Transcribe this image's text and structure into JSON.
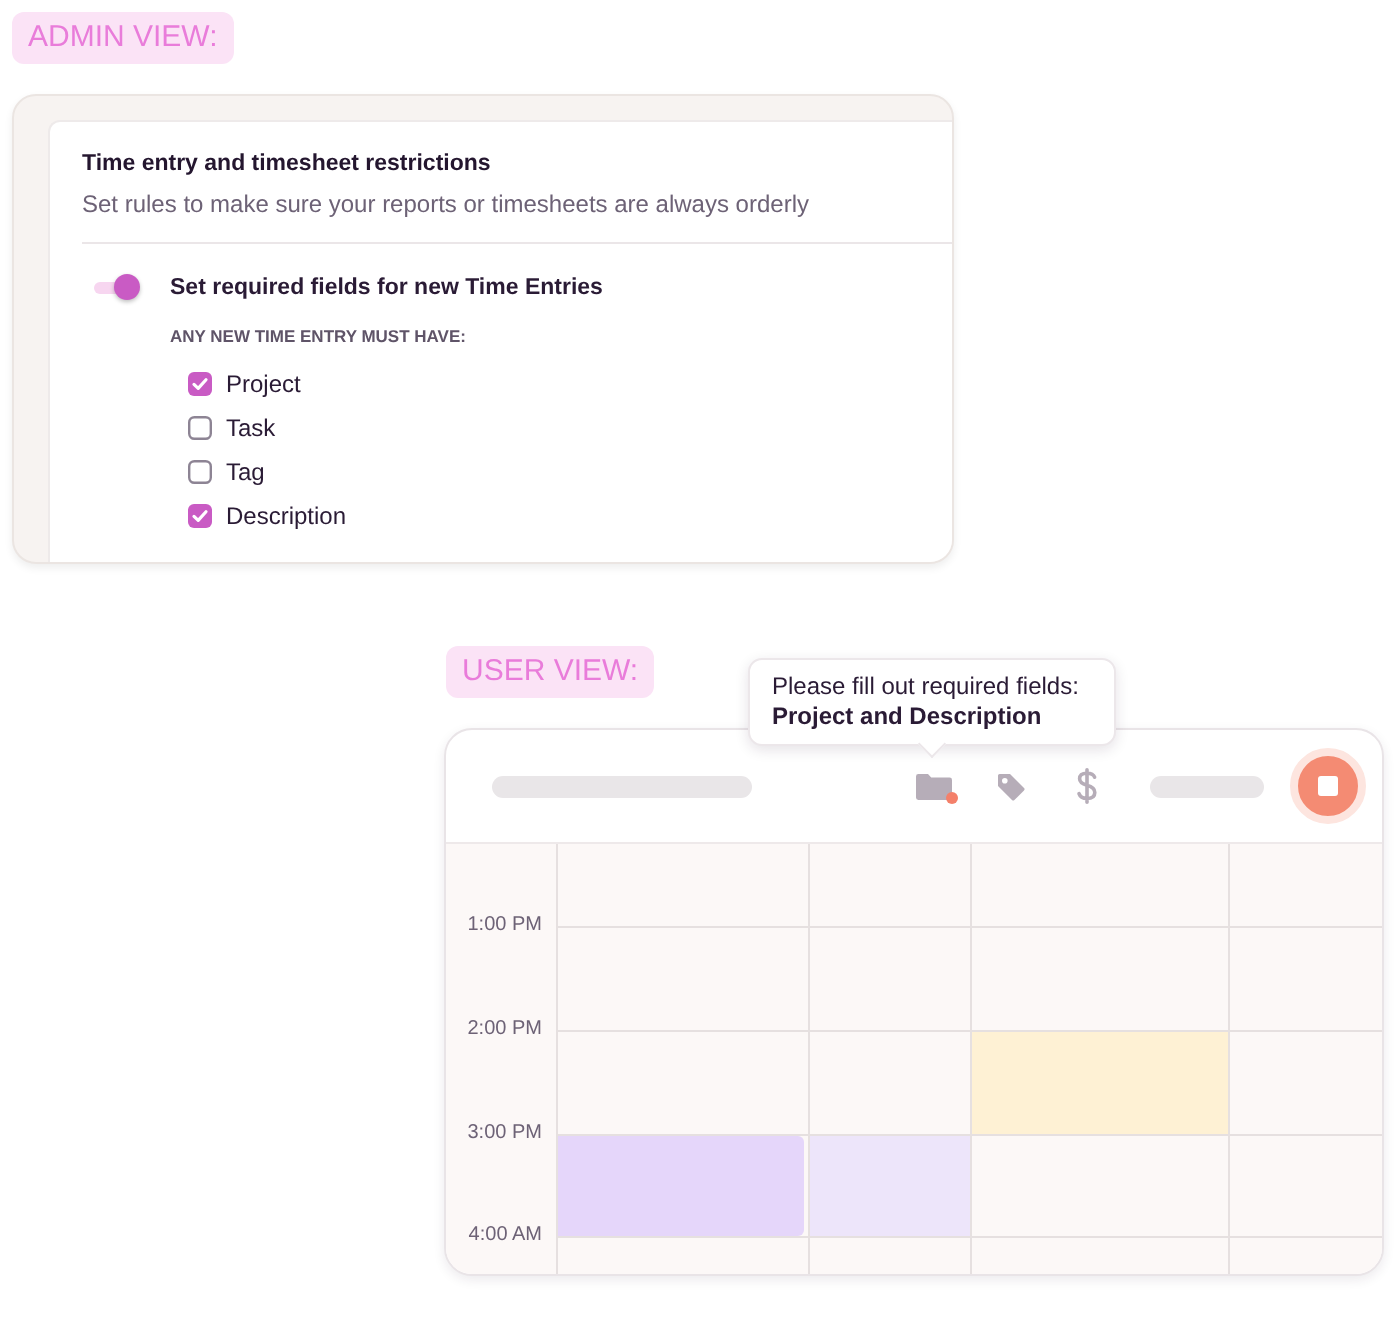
{
  "admin": {
    "badge": "ADMIN VIEW:",
    "title": "Time entry and timesheet restrictions",
    "subtitle": "Set rules to make sure your reports or timesheets are always orderly",
    "rule": {
      "label": "Set required fields for new Time Entries",
      "on": true
    },
    "fields_heading": "ANY NEW TIME ENTRY MUST HAVE:",
    "fields": [
      {
        "label": "Project",
        "checked": true
      },
      {
        "label": "Task",
        "checked": false
      },
      {
        "label": "Tag",
        "checked": false
      },
      {
        "label": "Description",
        "checked": true
      }
    ]
  },
  "user": {
    "badge": "USER VIEW:",
    "tooltip": {
      "message": "Please fill out required fields:",
      "fields": "Project and Description"
    },
    "toolbar": [
      {
        "kind": "project",
        "alert": true
      },
      {
        "kind": "tag",
        "alert": false
      },
      {
        "kind": "billable",
        "alert": false
      }
    ],
    "timer": {
      "running": true
    },
    "calendar": {
      "slots": [
        {
          "cells": [
            {
              "event": false
            },
            {
              "event": false
            },
            {
              "event": false
            },
            {
              "event": false
            }
          ]
        },
        {
          "time": "1:00 PM",
          "cells": [
            {
              "event": false
            },
            {
              "event": false
            },
            {
              "event": false
            },
            {
              "event": false
            }
          ]
        },
        {
          "time": "2:00 PM",
          "cells": [
            {
              "event": false
            },
            {
              "event": false
            },
            {
              "event": true,
              "color": "#fef1d4"
            },
            {
              "event": false
            }
          ]
        },
        {
          "time": "3:00 PM",
          "cells": [
            {
              "event": true,
              "color": "#e5d6fa"
            },
            {
              "event": true,
              "color": "#ede5fa"
            },
            {
              "event": false
            },
            {
              "event": false
            }
          ]
        },
        {
          "time": "4:00 AM",
          "cells": [
            {
              "event": false
            },
            {
              "event": false
            },
            {
              "event": false
            },
            {
              "event": false
            }
          ]
        }
      ]
    }
  }
}
